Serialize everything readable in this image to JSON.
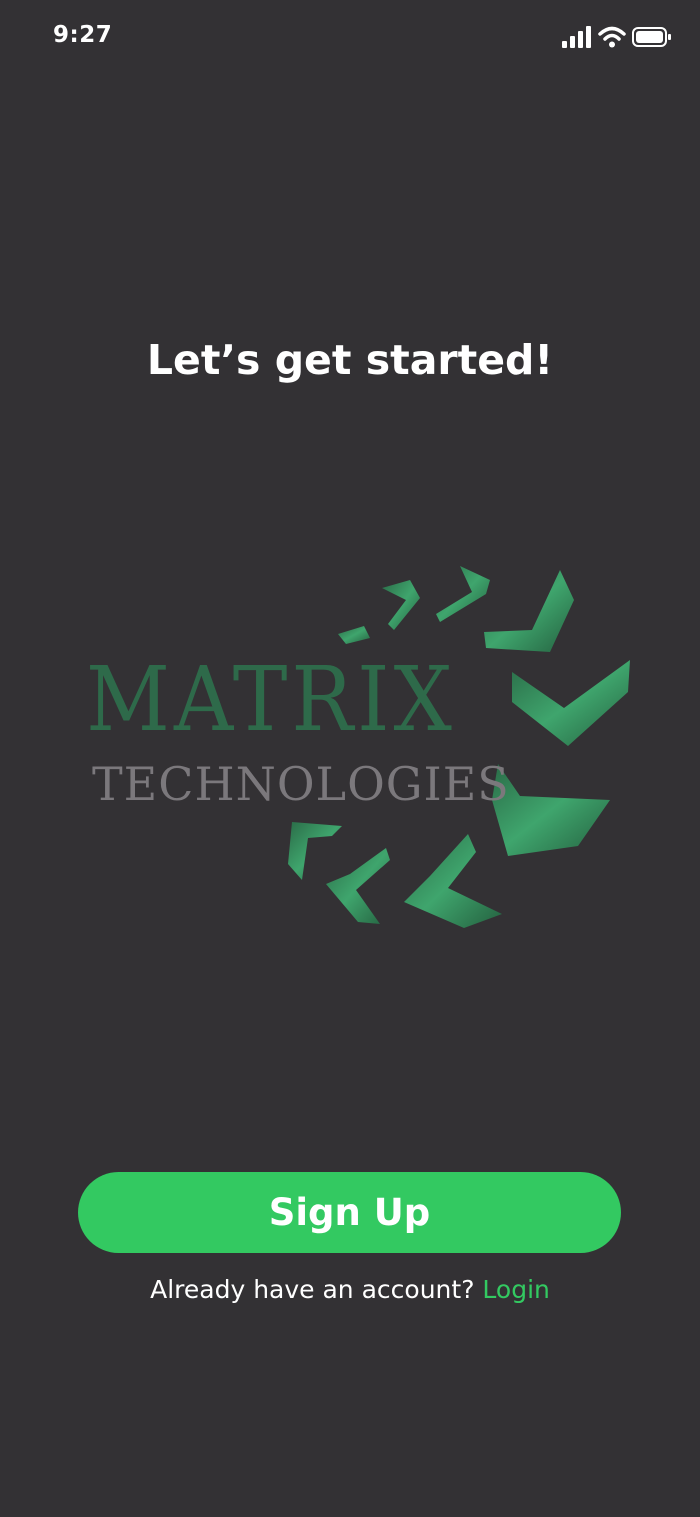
{
  "status_bar": {
    "time": "9:27",
    "icons": [
      "cellular-signal-icon",
      "wifi-icon",
      "battery-icon"
    ]
  },
  "headline": "Let’s get started!",
  "logo": {
    "brand_main": "MATRIX",
    "brand_sub": "TECHNOLOGIES"
  },
  "signup_button": "Sign Up",
  "login_prompt": {
    "text": "Already have an account?",
    "link": "Login"
  },
  "colors": {
    "background": "#333134",
    "accent_green": "#33c961",
    "logo_green": "#2e6a4a",
    "logo_gray": "#7b787c"
  }
}
